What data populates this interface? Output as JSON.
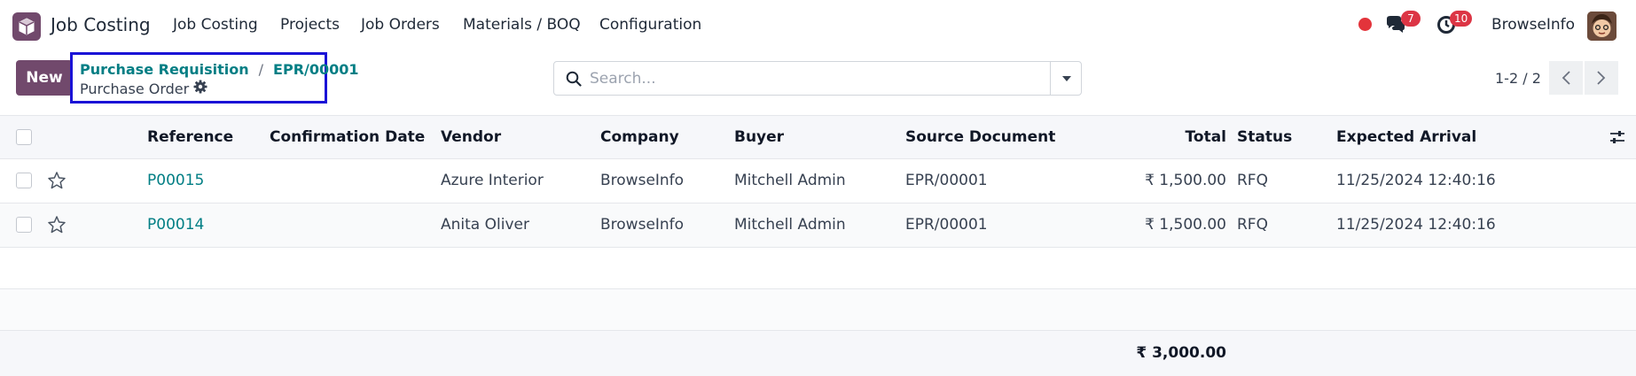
{
  "app": {
    "name": "Job Costing",
    "icon": "box-icon"
  },
  "nav": {
    "menu": [
      "Job Costing",
      "Projects",
      "Job Orders",
      "Materials / BOQ",
      "Configuration"
    ],
    "messages_count": "7",
    "activities_count": "10",
    "user_name": "BrowseInfo"
  },
  "control": {
    "new_label": "New",
    "breadcrumb": {
      "parent": "Purchase Requisition",
      "record": "EPR/00001",
      "current": "Purchase Order"
    },
    "search_placeholder": "Search...",
    "pager": "1-2 / 2"
  },
  "table": {
    "headers": {
      "reference": "Reference",
      "confirmation_date": "Confirmation Date",
      "vendor": "Vendor",
      "company": "Company",
      "buyer": "Buyer",
      "source_document": "Source Document",
      "total": "Total",
      "status": "Status",
      "expected_arrival": "Expected Arrival"
    },
    "rows": [
      {
        "reference": "P00015",
        "confirmation_date": "",
        "vendor": "Azure Interior",
        "company": "BrowseInfo",
        "buyer": "Mitchell Admin",
        "source_document": "EPR/00001",
        "total": "₹ 1,500.00",
        "status": "RFQ",
        "expected_arrival": "11/25/2024 12:40:16"
      },
      {
        "reference": "P00014",
        "confirmation_date": "",
        "vendor": "Anita Oliver",
        "company": "BrowseInfo",
        "buyer": "Mitchell Admin",
        "source_document": "EPR/00001",
        "total": "₹ 1,500.00",
        "status": "RFQ",
        "expected_arrival": "11/25/2024 12:40:16"
      }
    ],
    "grand_total": "₹ 3,000.00"
  },
  "colors": {
    "brand": "#71496c",
    "link": "#017e84",
    "highlight_border": "#1a12d6",
    "badge": "#dc3545"
  }
}
